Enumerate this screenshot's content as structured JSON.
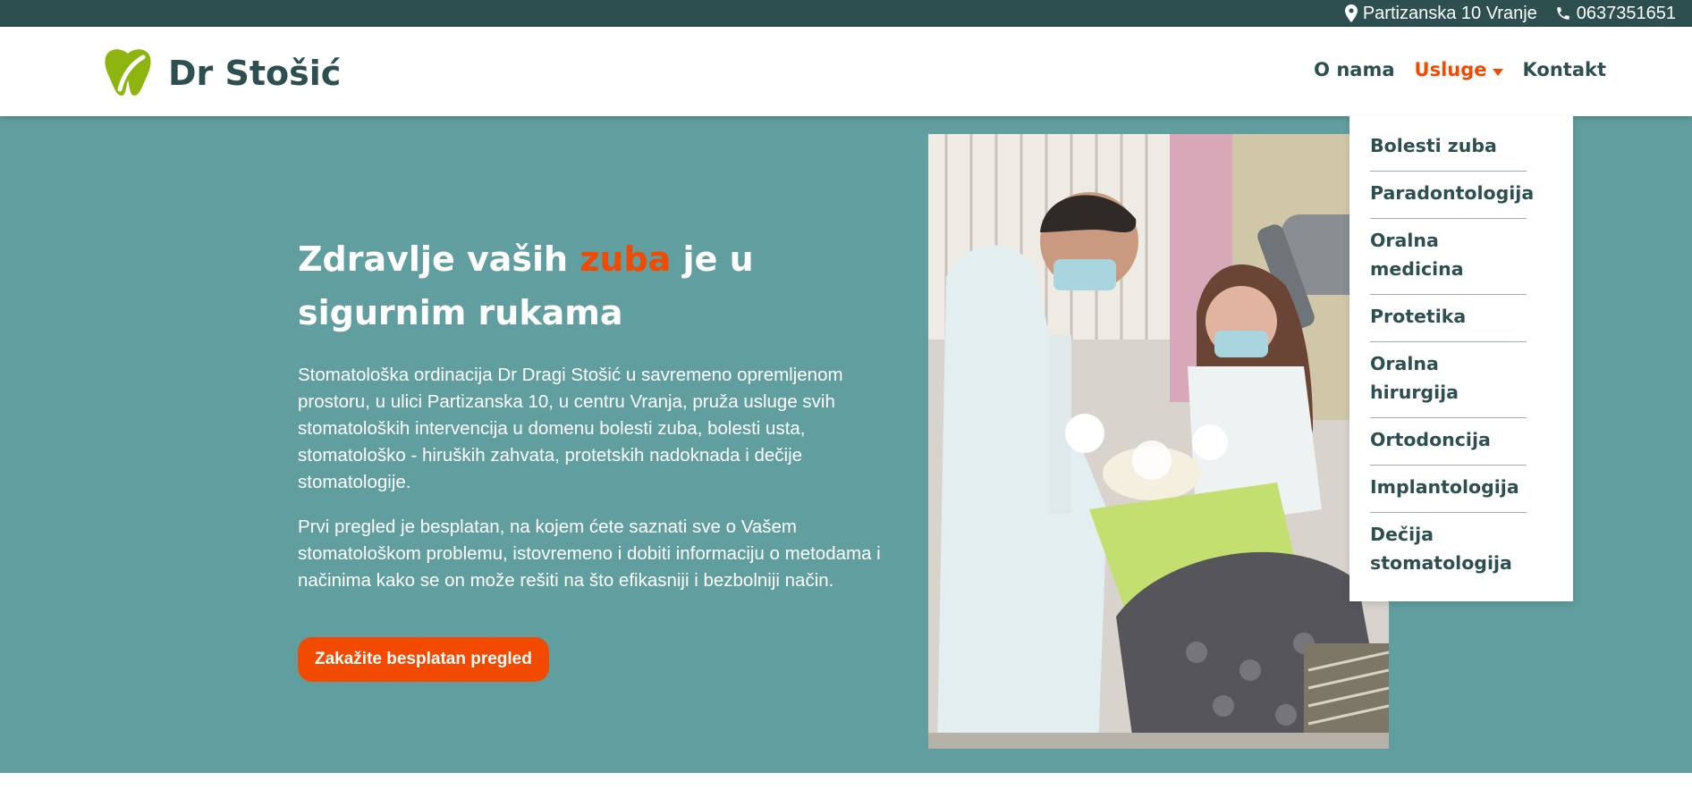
{
  "topbar": {
    "address": "Partizanska 10 Vranje",
    "phone": "0637351651",
    "icons": [
      "map-marker-icon",
      "phone-icon"
    ]
  },
  "header": {
    "brand": "Dr Stošić",
    "nav": [
      {
        "label": "O nama",
        "active": false
      },
      {
        "label": "Usluge",
        "active": true,
        "has_dropdown": true
      },
      {
        "label": "Kontakt",
        "active": false
      }
    ]
  },
  "dropdown": {
    "items": [
      "Bolesti zuba",
      "Paradontologija",
      "Oralna medicina",
      "Protetika",
      "Oralna hirurgija",
      "Ortodoncija",
      "Implantologija",
      "Dečija stomatologija"
    ]
  },
  "hero": {
    "title_part1": "Zdravlje vaših ",
    "title_accent": "zuba",
    "title_part2": " je u sigurnim rukama",
    "paragraph1": "Stomatološka ordinacija Dr Dragi Stošić u savremeno opremljenom prostoru, u ulici Partizanska 10, u centru Vranja, pruža usluge svih stomatoloških intervencija u domenu bolesti zuba, bolesti usta, stomatološko - hiruških zahvata, protetskih nadoknada i dečije stomatologije.",
    "paragraph2": "Prvi pregled je besplatan, na kojem ćete saznati sve o Vašem stomatološkom problemu, istovremeno i dobiti informaciju o metodama i načinima kako se on može rešiti na što efikasniji i bezbolniji način.",
    "cta_label": "Zakažite besplatan pregled"
  },
  "colors": {
    "dark_teal": "#2d4f50",
    "hero_teal": "#619e9f",
    "accent_orange": "#f24a00",
    "logo_green": "#8db40f"
  }
}
